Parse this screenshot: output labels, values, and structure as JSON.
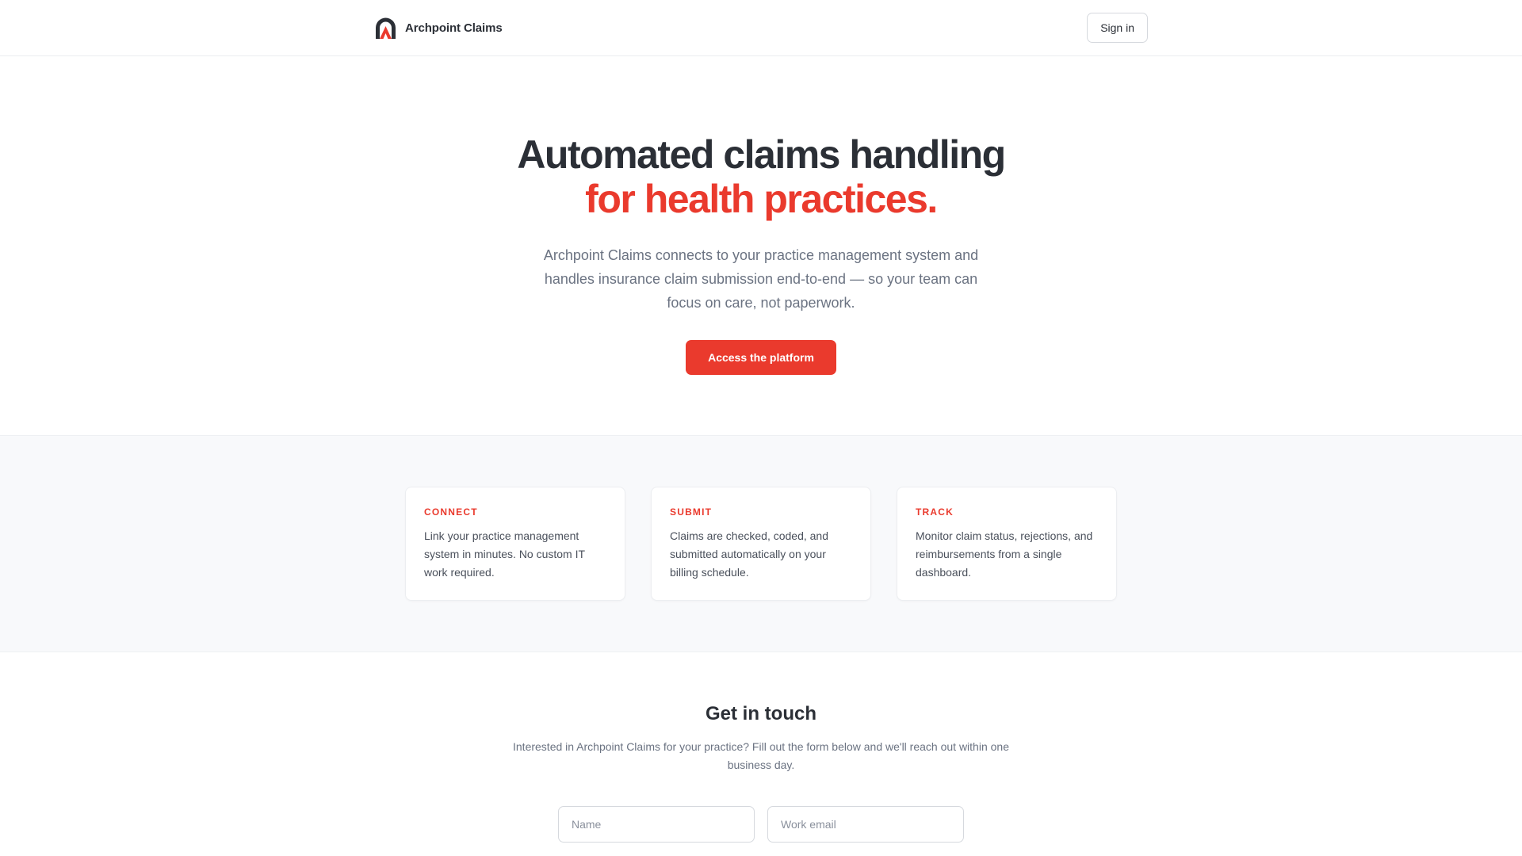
{
  "brand": {
    "name": "Archpoint Claims",
    "logo_icon": "arch-logo-icon",
    "colors": {
      "dark": "#2b2f36",
      "accent": "#ea3a2d"
    }
  },
  "nav": {
    "signin_label": "Sign in"
  },
  "hero": {
    "headline_line1": "Automated claims handling",
    "headline_line2": "for health practices.",
    "description": "Archpoint Claims connects to your practice management system and handles insurance claim submission end-to-end — so your team can focus on care, not paperwork.",
    "cta_label": "Access the platform"
  },
  "features": [
    {
      "title": "CONNECT",
      "body": "Link your practice management system in minutes. No custom IT work required."
    },
    {
      "title": "SUBMIT",
      "body": "Claims are checked, coded, and submitted automatically on your billing schedule."
    },
    {
      "title": "TRACK",
      "body": "Monitor claim status, rejections, and reimbursements from a single dashboard."
    }
  ],
  "contact": {
    "heading": "Get in touch",
    "description": "Interested in Archpoint Claims for your practice? Fill out the form below and we'll reach out within one business day.",
    "name_placeholder": "Name",
    "email_placeholder": "Work email"
  }
}
